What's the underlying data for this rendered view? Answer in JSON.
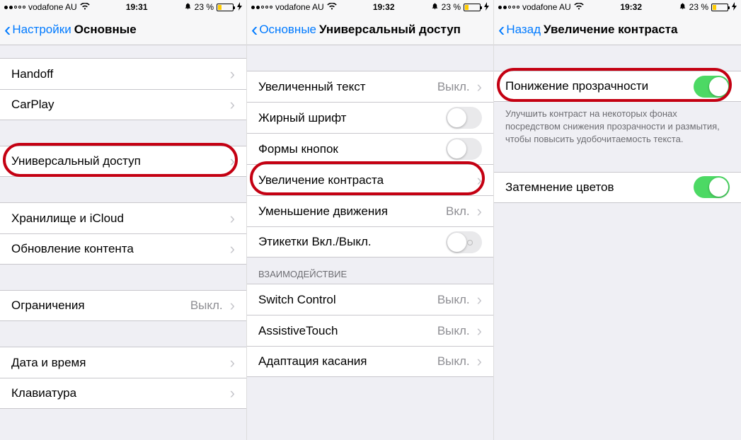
{
  "status": {
    "carrier": "vodafone AU",
    "battery_pct": "23 %"
  },
  "screens": [
    {
      "time": "19:31",
      "back": "Настройки",
      "title": "Основные",
      "groups": [
        {
          "spacer": true
        },
        {
          "cells": [
            {
              "label": "Handoff",
              "type": "disclosure"
            },
            {
              "label": "CarPlay",
              "type": "disclosure"
            }
          ]
        },
        {
          "spacer": true,
          "large": true
        },
        {
          "cells": [
            {
              "label": "Универсальный доступ",
              "type": "disclosure",
              "highlight": true
            }
          ]
        },
        {
          "spacer": true,
          "large": true
        },
        {
          "cells": [
            {
              "label": "Хранилище и iCloud",
              "type": "disclosure"
            },
            {
              "label": "Обновление контента",
              "type": "disclosure"
            }
          ]
        },
        {
          "spacer": true,
          "large": true
        },
        {
          "cells": [
            {
              "label": "Ограничения",
              "value": "Выкл.",
              "type": "disclosure"
            }
          ]
        },
        {
          "spacer": true,
          "large": true
        },
        {
          "cells": [
            {
              "label": "Дата и время",
              "type": "disclosure"
            },
            {
              "label": "Клавиатура",
              "type": "disclosure"
            }
          ]
        }
      ]
    },
    {
      "time": "19:32",
      "back": "Основные",
      "title": "Универсальный доступ",
      "groups": [
        {
          "spacer": true,
          "large": true
        },
        {
          "cells": [
            {
              "label": "Увеличенный текст",
              "value": "Выкл.",
              "type": "disclosure"
            },
            {
              "label": "Жирный шрифт",
              "type": "toggle",
              "on": false
            },
            {
              "label": "Формы кнопок",
              "type": "toggle",
              "on": false
            },
            {
              "label": "Увеличение контраста",
              "type": "disclosure",
              "highlight": true
            },
            {
              "label": "Уменьшение движения",
              "value": "Вкл.",
              "type": "disclosure"
            },
            {
              "label": "Этикетки Вкл./Выкл.",
              "type": "toggle",
              "on": false,
              "labeled": true
            }
          ]
        },
        {
          "header": "ВЗАИМОДЕЙСТВИЕ",
          "cells": [
            {
              "label": "Switch Control",
              "value": "Выкл.",
              "type": "disclosure"
            },
            {
              "label": "AssistiveTouch",
              "value": "Выкл.",
              "type": "disclosure"
            },
            {
              "label": "Адаптация касания",
              "value": "Выкл.",
              "type": "disclosure"
            }
          ]
        }
      ]
    },
    {
      "time": "19:32",
      "back": "Назад",
      "title": "Увеличение контраста",
      "groups": [
        {
          "spacer": true,
          "large": true
        },
        {
          "cells": [
            {
              "label": "Понижение прозрачности",
              "type": "toggle",
              "on": true,
              "highlight": true
            }
          ],
          "footer": "Улучшить контраст на некоторых фонах посредством снижения прозрачности и размытия, чтобы повысить удобочитаемость текста."
        },
        {
          "spacer": true,
          "large": true
        },
        {
          "cells": [
            {
              "label": "Затемнение цветов",
              "type": "toggle",
              "on": true
            }
          ]
        }
      ]
    }
  ]
}
